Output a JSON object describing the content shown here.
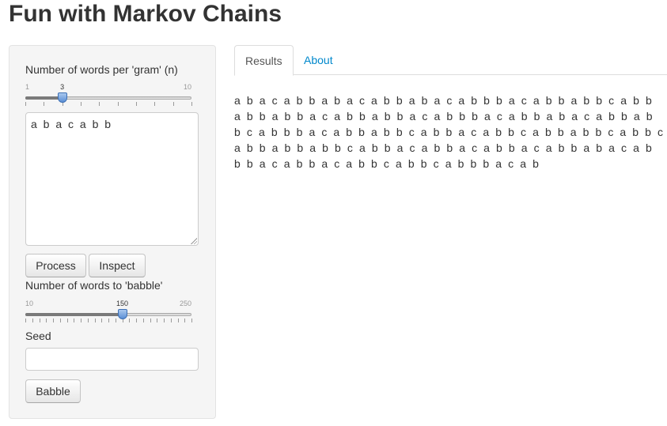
{
  "app": {
    "title": "Fun with Markov Chains"
  },
  "sidebar": {
    "ngram_label": "Number of words per 'gram' (n)",
    "ngram_slider": {
      "min": 1,
      "max": 10,
      "value": 3,
      "min_label": "1",
      "max_label": "10",
      "value_label": "3"
    },
    "corpus_text": "a b a c a b b",
    "process_button": "Process",
    "inspect_button": "Inspect",
    "babble_label": "Number of words to 'babble'",
    "babble_slider": {
      "min": 10,
      "max": 250,
      "value": 150,
      "min_label": "10",
      "max_label": "250",
      "value_label": "150"
    },
    "seed_label": "Seed",
    "seed_value": "",
    "babble_button": "Babble"
  },
  "tabs": [
    {
      "label": "Results",
      "active": true
    },
    {
      "label": "About",
      "active": false
    }
  ],
  "results": {
    "text": "a b a c a b b a b a c a b b a b a c a b b b a c a b b a b b c a b b a b b a b b a c a b b a b b a c a b b b a c a b b a b a c a b b a b b c a b b b a c a b b a b b c a b b a c a b b c a b b a b b c a b b c a b b a b b a b b c a b b a c a b b a c a b b a c a b b a b a c a b b b a c a b b a c a b b c a b b c a b b b a c a b"
  },
  "colors": {
    "accent_link": "#0088cc",
    "slider_handle": "#5b8fd6",
    "panel_bg": "#f5f5f5"
  }
}
